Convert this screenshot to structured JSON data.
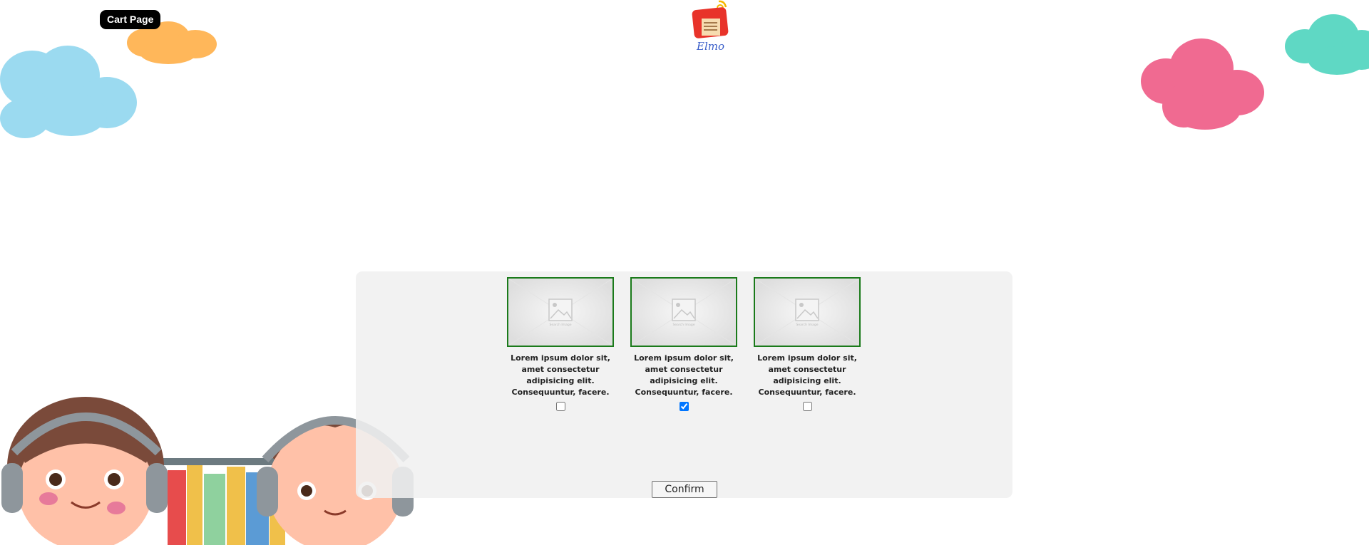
{
  "header": {
    "cart_button_label": "Cart Page",
    "logo_text": "Elmo"
  },
  "colors": {
    "cloud_blue": "#9bdaf0",
    "cloud_orange": "#ffb75a",
    "cloud_pink": "#f06a91",
    "cloud_teal": "#5fd8c4",
    "card_border": "#1a7a1a",
    "checkbox_checked": "#1a73e8"
  },
  "products": [
    {
      "image_label": "Search Image",
      "description": "Lorem ipsum dolor sit, amet consectetur adipisicing elit. Consequuntur, facere.",
      "checked": false
    },
    {
      "image_label": "Search Image",
      "description": "Lorem ipsum dolor sit, amet consectetur adipisicing elit. Consequuntur, facere.",
      "checked": true
    },
    {
      "image_label": "Search Image",
      "description": "Lorem ipsum dolor sit, amet consectetur adipisicing elit. Consequuntur, facere.",
      "checked": false
    }
  ],
  "confirm_label": "Confirm"
}
